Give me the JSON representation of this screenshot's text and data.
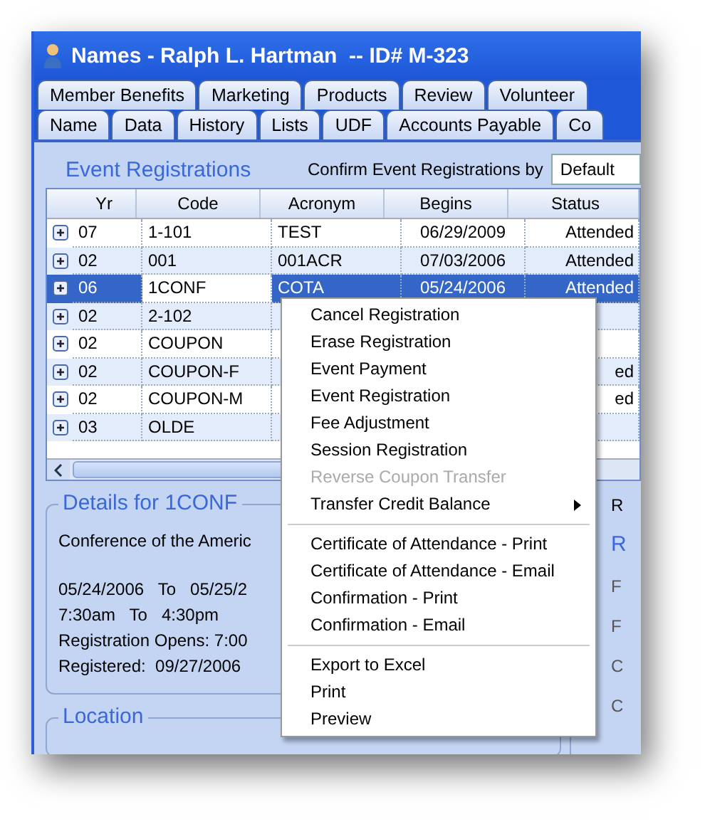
{
  "window": {
    "title": "Names - Ralph L. Hartman  -- ID# M-323"
  },
  "tab_rows": [
    [
      {
        "label": "Member Benefits"
      },
      {
        "label": "Marketing"
      },
      {
        "label": "Products"
      },
      {
        "label": "Review"
      },
      {
        "label": "Volunteer"
      }
    ],
    [
      {
        "label": "Name"
      },
      {
        "label": "Data"
      },
      {
        "label": "History"
      },
      {
        "label": "Lists"
      },
      {
        "label": "UDF"
      },
      {
        "label": "Accounts Payable"
      },
      {
        "label": "Co"
      }
    ]
  ],
  "section_title": "Event Registrations",
  "confirm": {
    "label": "Confirm Event Registrations by",
    "value": "Default"
  },
  "table": {
    "columns": [
      "Yr",
      "Code",
      "Acronym",
      "Begins",
      "Status"
    ],
    "rows": [
      {
        "cells": [
          "07",
          "1-101",
          "TEST",
          "06/29/2009",
          "Attended"
        ],
        "selected": false
      },
      {
        "cells": [
          "02",
          "001",
          "001ACR",
          "07/03/2006",
          "Attended"
        ],
        "selected": false
      },
      {
        "cells": [
          "06",
          "1CONF",
          "COTA",
          "05/24/2006",
          "Attended"
        ],
        "selected": true
      },
      {
        "cells": [
          "02",
          "2-102",
          "",
          "",
          ""
        ],
        "selected": false
      },
      {
        "cells": [
          "02",
          "COUPON",
          "",
          "",
          ""
        ],
        "selected": false
      },
      {
        "cells": [
          "02",
          "COUPON-F",
          "",
          "",
          "ed"
        ],
        "selected": false
      },
      {
        "cells": [
          "02",
          "COUPON-M",
          "",
          "",
          "ed"
        ],
        "selected": false
      },
      {
        "cells": [
          "03",
          "OLDE",
          "",
          "",
          ""
        ],
        "selected": false
      }
    ]
  },
  "details": {
    "title": "Details for 1CONF",
    "blocks": [
      [
        "Conference of the Americ"
      ],
      [
        "05/24/2006   To   05/25/2",
        "7:30am   To   4:30pm",
        "Registration Opens: 7:00",
        "Registered:  09/27/2006"
      ]
    ]
  },
  "location": {
    "title": "Location"
  },
  "right_panel": {
    "tab": "R",
    "heading": "R",
    "labels": [
      "F",
      "F",
      "C",
      "C"
    ]
  },
  "context_menu": {
    "groups": [
      [
        {
          "label": "Cancel Registration",
          "disabled": false,
          "submenu": false
        },
        {
          "label": "Erase Registration",
          "disabled": false,
          "submenu": false
        },
        {
          "label": "Event Payment",
          "disabled": false,
          "submenu": false
        },
        {
          "label": "Event Registration",
          "disabled": false,
          "submenu": false
        },
        {
          "label": "Fee Adjustment",
          "disabled": false,
          "submenu": false
        },
        {
          "label": "Session Registration",
          "disabled": false,
          "submenu": false
        },
        {
          "label": "Reverse Coupon Transfer",
          "disabled": true,
          "submenu": false
        },
        {
          "label": "Transfer Credit Balance",
          "disabled": false,
          "submenu": true
        }
      ],
      [
        {
          "label": "Certificate of Attendance - Print",
          "disabled": false,
          "submenu": false
        },
        {
          "label": "Certificate of Attendance - Email",
          "disabled": false,
          "submenu": false
        },
        {
          "label": "Confirmation - Print",
          "disabled": false,
          "submenu": false
        },
        {
          "label": "Confirmation - Email",
          "disabled": false,
          "submenu": false
        }
      ],
      [
        {
          "label": "Export to Excel",
          "disabled": false,
          "submenu": false
        },
        {
          "label": "Print",
          "disabled": false,
          "submenu": false
        },
        {
          "label": "Preview",
          "disabled": false,
          "submenu": false
        }
      ]
    ]
  }
}
